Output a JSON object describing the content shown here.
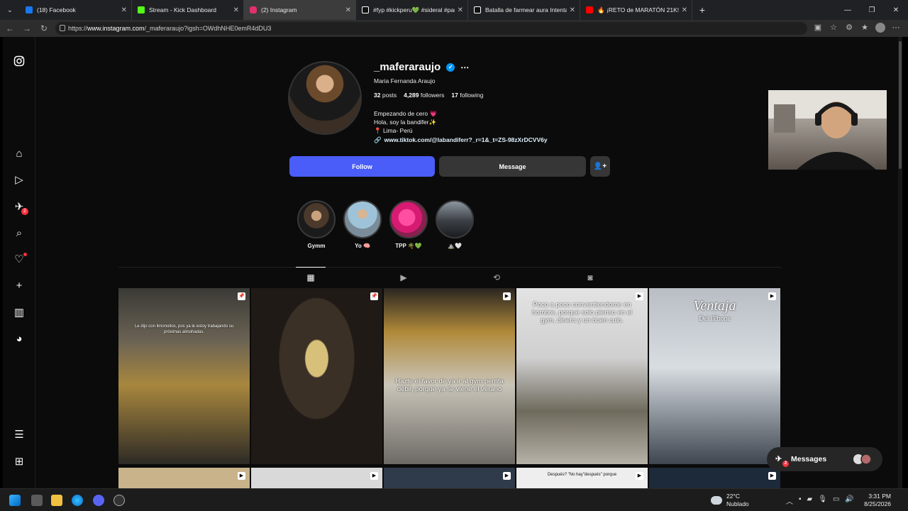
{
  "browser": {
    "tabs": [
      {
        "title": "(18) Facebook",
        "icon_color": "#1877f2"
      },
      {
        "title": "Stream - Kick Dashboard",
        "icon_color": "#53fc18"
      },
      {
        "title": "(2) Instagram",
        "icon_color": "#e1306c",
        "active": true
      },
      {
        "title": "#fyp #kickperu💚 #sideral #parat",
        "icon_color": "#ffffff"
      },
      {
        "title": "Batalla de farmear aura Intenta fa",
        "icon_color": "#ffffff"
      },
      {
        "title": "🔥 ¡RETO de MARATÓN 21K! 🏃",
        "icon_color": "#ff0000"
      }
    ],
    "url_prefix": "https://",
    "url_host": "www.instagram.com",
    "url_path": "/_maferaraujo?igsh=OWdhNHE0emR4dDU3"
  },
  "profile": {
    "username": "_maferaraujo",
    "full_name": "Maria Fernanda Araujo",
    "posts_count": "32",
    "posts_label": "posts",
    "followers_count": "4,289",
    "followers_label": "followers",
    "following_count": "17",
    "following_label": "following",
    "bio_line1": "Empezando de cero 💗",
    "bio_line2": "Hola, soy la bandifer✨",
    "bio_line3": "📍 Lima- Perú",
    "link": "www.tiktok.com/@labandiferr?_r=1&_t=ZS-98zXrDCVV6y",
    "follow_label": "Follow",
    "message_label": "Message"
  },
  "highlights": [
    {
      "label": "Gymm"
    },
    {
      "label": "Yo 🧠"
    },
    {
      "label": "TPP 🌴💚"
    },
    {
      "label": "⛰️🤍"
    }
  ],
  "posts": [
    {
      "caption": "Le dijo con limonoitos, pos ya le estoy trabajando su próximas almohadas."
    },
    {
      "caption": ""
    },
    {
      "caption": "Hazte el favor de ya ir al gym perrita débil, porque ya se viene el verano"
    },
    {
      "caption": "Poco a poco conventiendome en hombre, porque solo pienso en el gym, dinero y un buen culo."
    },
    {
      "caption": "Ventaja",
      "sub": "Del iPhone"
    }
  ],
  "row2_caption": "Después? \"No hay\"después\" porque",
  "messages_label": "Messages",
  "messages_badge": "2",
  "sidebar_badge": "2",
  "taskbar": {
    "temp": "22°C",
    "weather": "Nublado",
    "time": "3:31 PM",
    "date": "8/25/2026"
  }
}
